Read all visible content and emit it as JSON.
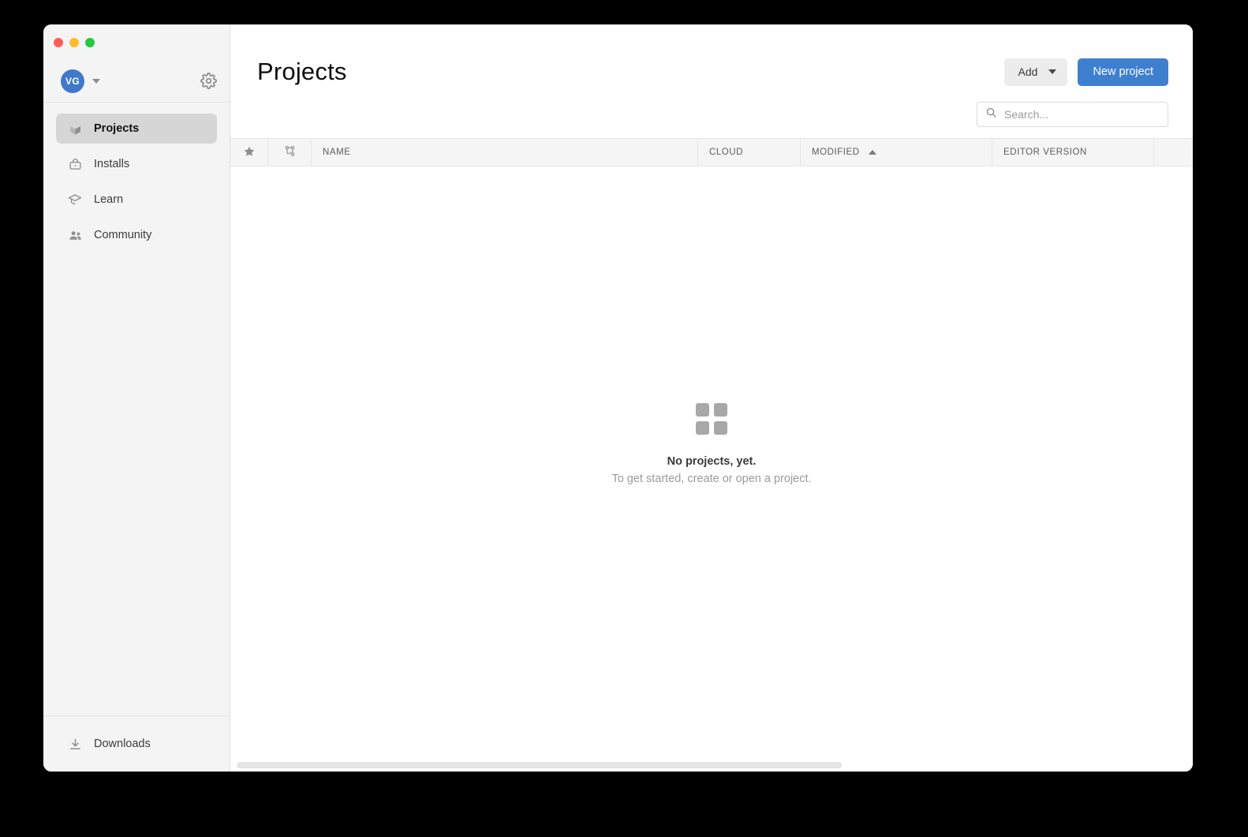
{
  "window": {
    "traffic_lights": [
      {
        "name": "close",
        "color": "#ff5f57"
      },
      {
        "name": "minimize",
        "color": "#febc2e"
      },
      {
        "name": "zoom",
        "color": "#28c840"
      }
    ]
  },
  "sidebar": {
    "account": {
      "avatar_initials": "VG",
      "avatar_color": "#4178c8",
      "dropdown_icon": "chevron-down-icon",
      "settings_icon": "gear-icon"
    },
    "items": [
      {
        "label": "Projects",
        "icon": "cube-icon",
        "active": true
      },
      {
        "label": "Installs",
        "icon": "unity-box-icon",
        "active": false
      },
      {
        "label": "Learn",
        "icon": "graduation-cap-icon",
        "active": false
      },
      {
        "label": "Community",
        "icon": "people-icon",
        "active": false
      }
    ],
    "footer": {
      "label": "Downloads",
      "icon": "download-icon"
    }
  },
  "header": {
    "title": "Projects",
    "add_button": "Add",
    "new_project_button": "New project",
    "accent_color": "#3f7fd0"
  },
  "search": {
    "placeholder": "Search...",
    "value": "",
    "icon": "search-icon"
  },
  "table": {
    "columns": [
      {
        "key": "favorite",
        "label": "",
        "icon": "star-icon",
        "sorted": ""
      },
      {
        "key": "vcs",
        "label": "",
        "icon": "branch-icon",
        "sorted": ""
      },
      {
        "key": "name",
        "label": "NAME",
        "icon": "",
        "sorted": ""
      },
      {
        "key": "cloud",
        "label": "CLOUD",
        "icon": "",
        "sorted": ""
      },
      {
        "key": "modified",
        "label": "MODIFIED",
        "icon": "",
        "sorted": "asc"
      },
      {
        "key": "editor",
        "label": "EDITOR VERSION",
        "icon": "",
        "sorted": ""
      },
      {
        "key": "actions",
        "label": "",
        "icon": "",
        "sorted": ""
      }
    ],
    "rows": []
  },
  "empty_state": {
    "icon": "grid-squares-icon",
    "title": "No projects, yet.",
    "subtitle": "To get started, create or open a project."
  },
  "scrollbar": {
    "orientation": "horizontal",
    "thumb_color": "#e4e4e4"
  }
}
